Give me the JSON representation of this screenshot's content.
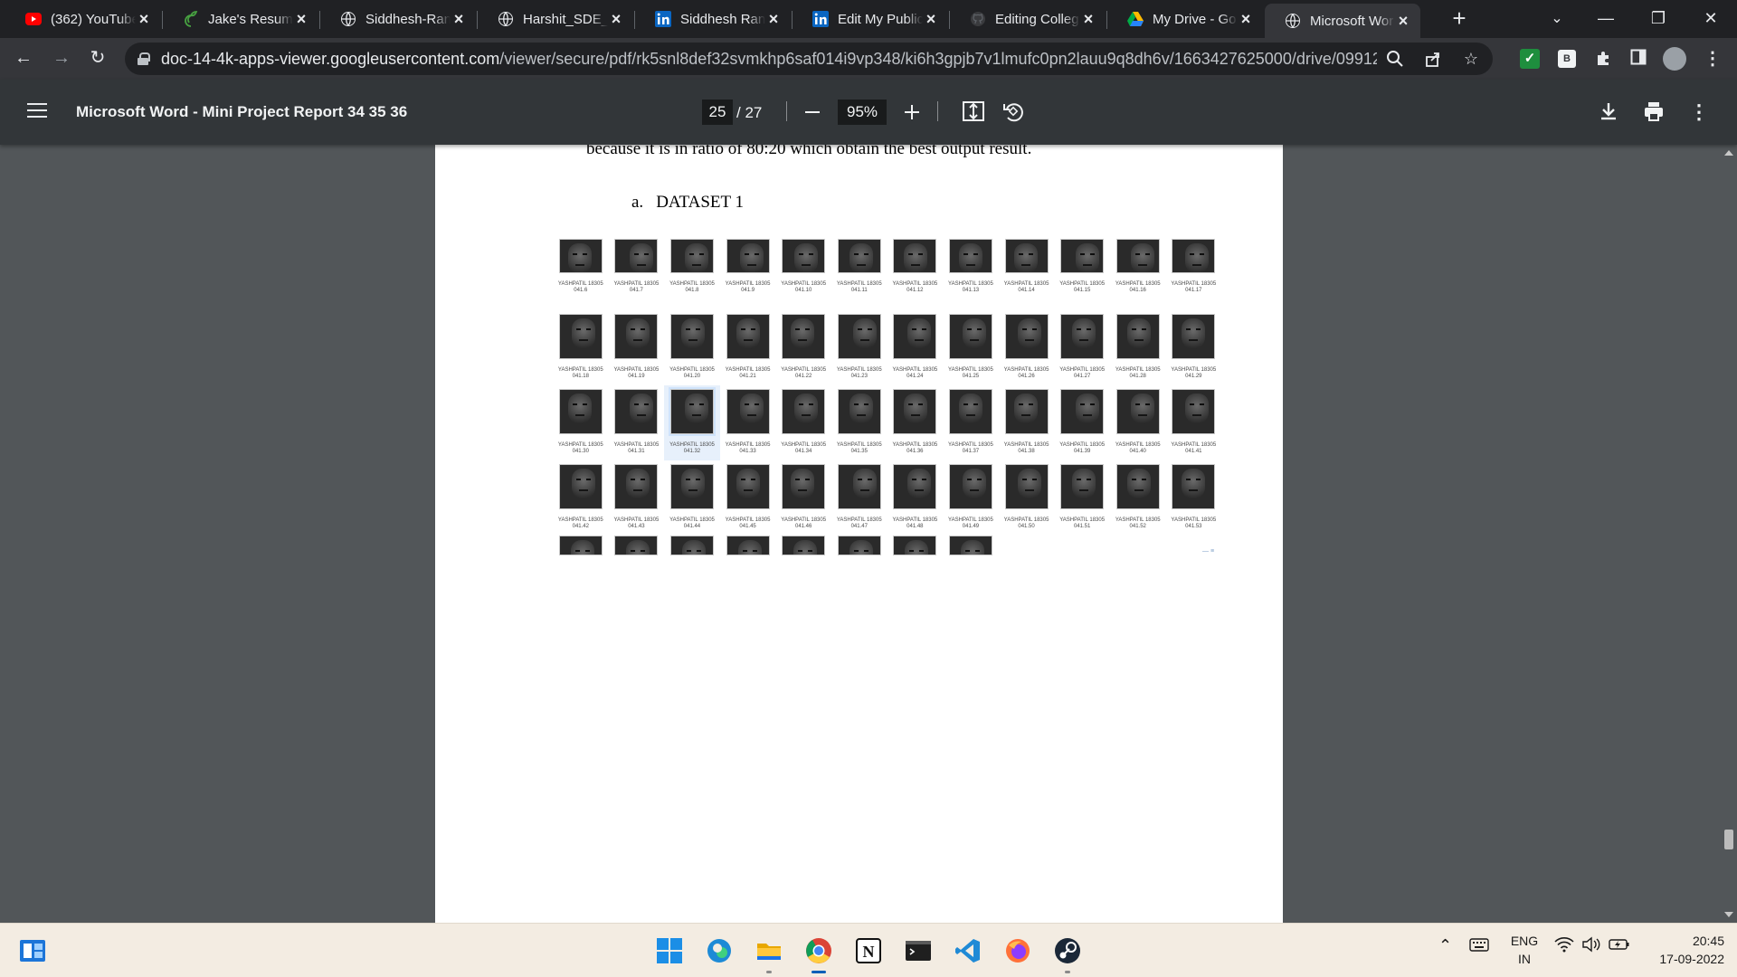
{
  "tabs": [
    {
      "title": "(362) YouTube",
      "icon": "youtube-icon"
    },
    {
      "title": "Jake's Resume",
      "icon": "overleaf-icon"
    },
    {
      "title": "Siddhesh-Rane",
      "icon": "globe-icon"
    },
    {
      "title": "Harshit_SDE_2",
      "icon": "globe-icon"
    },
    {
      "title": "Siddhesh Rane",
      "icon": "linkedin-icon"
    },
    {
      "title": "Edit My Public",
      "icon": "linkedin-icon"
    },
    {
      "title": "Editing Colleg",
      "icon": "github-icon"
    },
    {
      "title": "My Drive - Go",
      "icon": "google-drive-icon"
    },
    {
      "title": "Microsoft Wor",
      "icon": "globe-icon",
      "active": true
    }
  ],
  "omnibox": {
    "host": "doc-14-4k-apps-viewer.googleusercontent.com",
    "path": "/viewer/secure/pdf/rk5snl8def32svmkhp6saf014i9vp348/ki6h3gpjb7v1lmufc0pn2lauu9q8dh6v/1663427625000/drive/0991217..."
  },
  "pdf": {
    "title": "Microsoft Word - Mini Project Report 34 35 36",
    "current_page": "25",
    "total_pages": "/ 27",
    "zoom": "95%"
  },
  "document": {
    "body_line": "because it is in ratio of 80:20 which obtain the best output result.",
    "heading_label": "a.",
    "heading_text": "DATASET 1",
    "caption_prefix": "YASHPATIL 18305",
    "captions": [
      "041.6",
      "041.7",
      "041.8",
      "041.9",
      "041.10",
      "041.11",
      "041.12",
      "041.13",
      "041.14",
      "041.15",
      "041.16",
      "041.17",
      "041.18",
      "041.19",
      "041.20",
      "041.21",
      "041.22",
      "041.23",
      "041.24",
      "041.25",
      "041.26",
      "041.27",
      "041.28",
      "041.29",
      "041.30",
      "041.31",
      "041.32",
      "041.33",
      "041.34",
      "041.35",
      "041.36",
      "041.37",
      "041.38",
      "041.39",
      "041.40",
      "041.41",
      "041.42",
      "041.43",
      "041.44",
      "041.45",
      "041.46",
      "041.47",
      "041.48",
      "041.49",
      "041.50",
      "041.51",
      "041.52",
      "041.53"
    ],
    "partial_row_count": 8,
    "selected_caption": "041.32"
  },
  "taskbar": {
    "apps": [
      "start-icon",
      "edge-icon",
      "file-explorer-icon",
      "chrome-icon",
      "notion-icon",
      "terminal-icon",
      "vscode-icon",
      "firefox-icon",
      "steam-icon"
    ],
    "lang_top": "ENG",
    "lang_bottom": "IN",
    "time": "20:45",
    "date": "17-09-2022"
  }
}
